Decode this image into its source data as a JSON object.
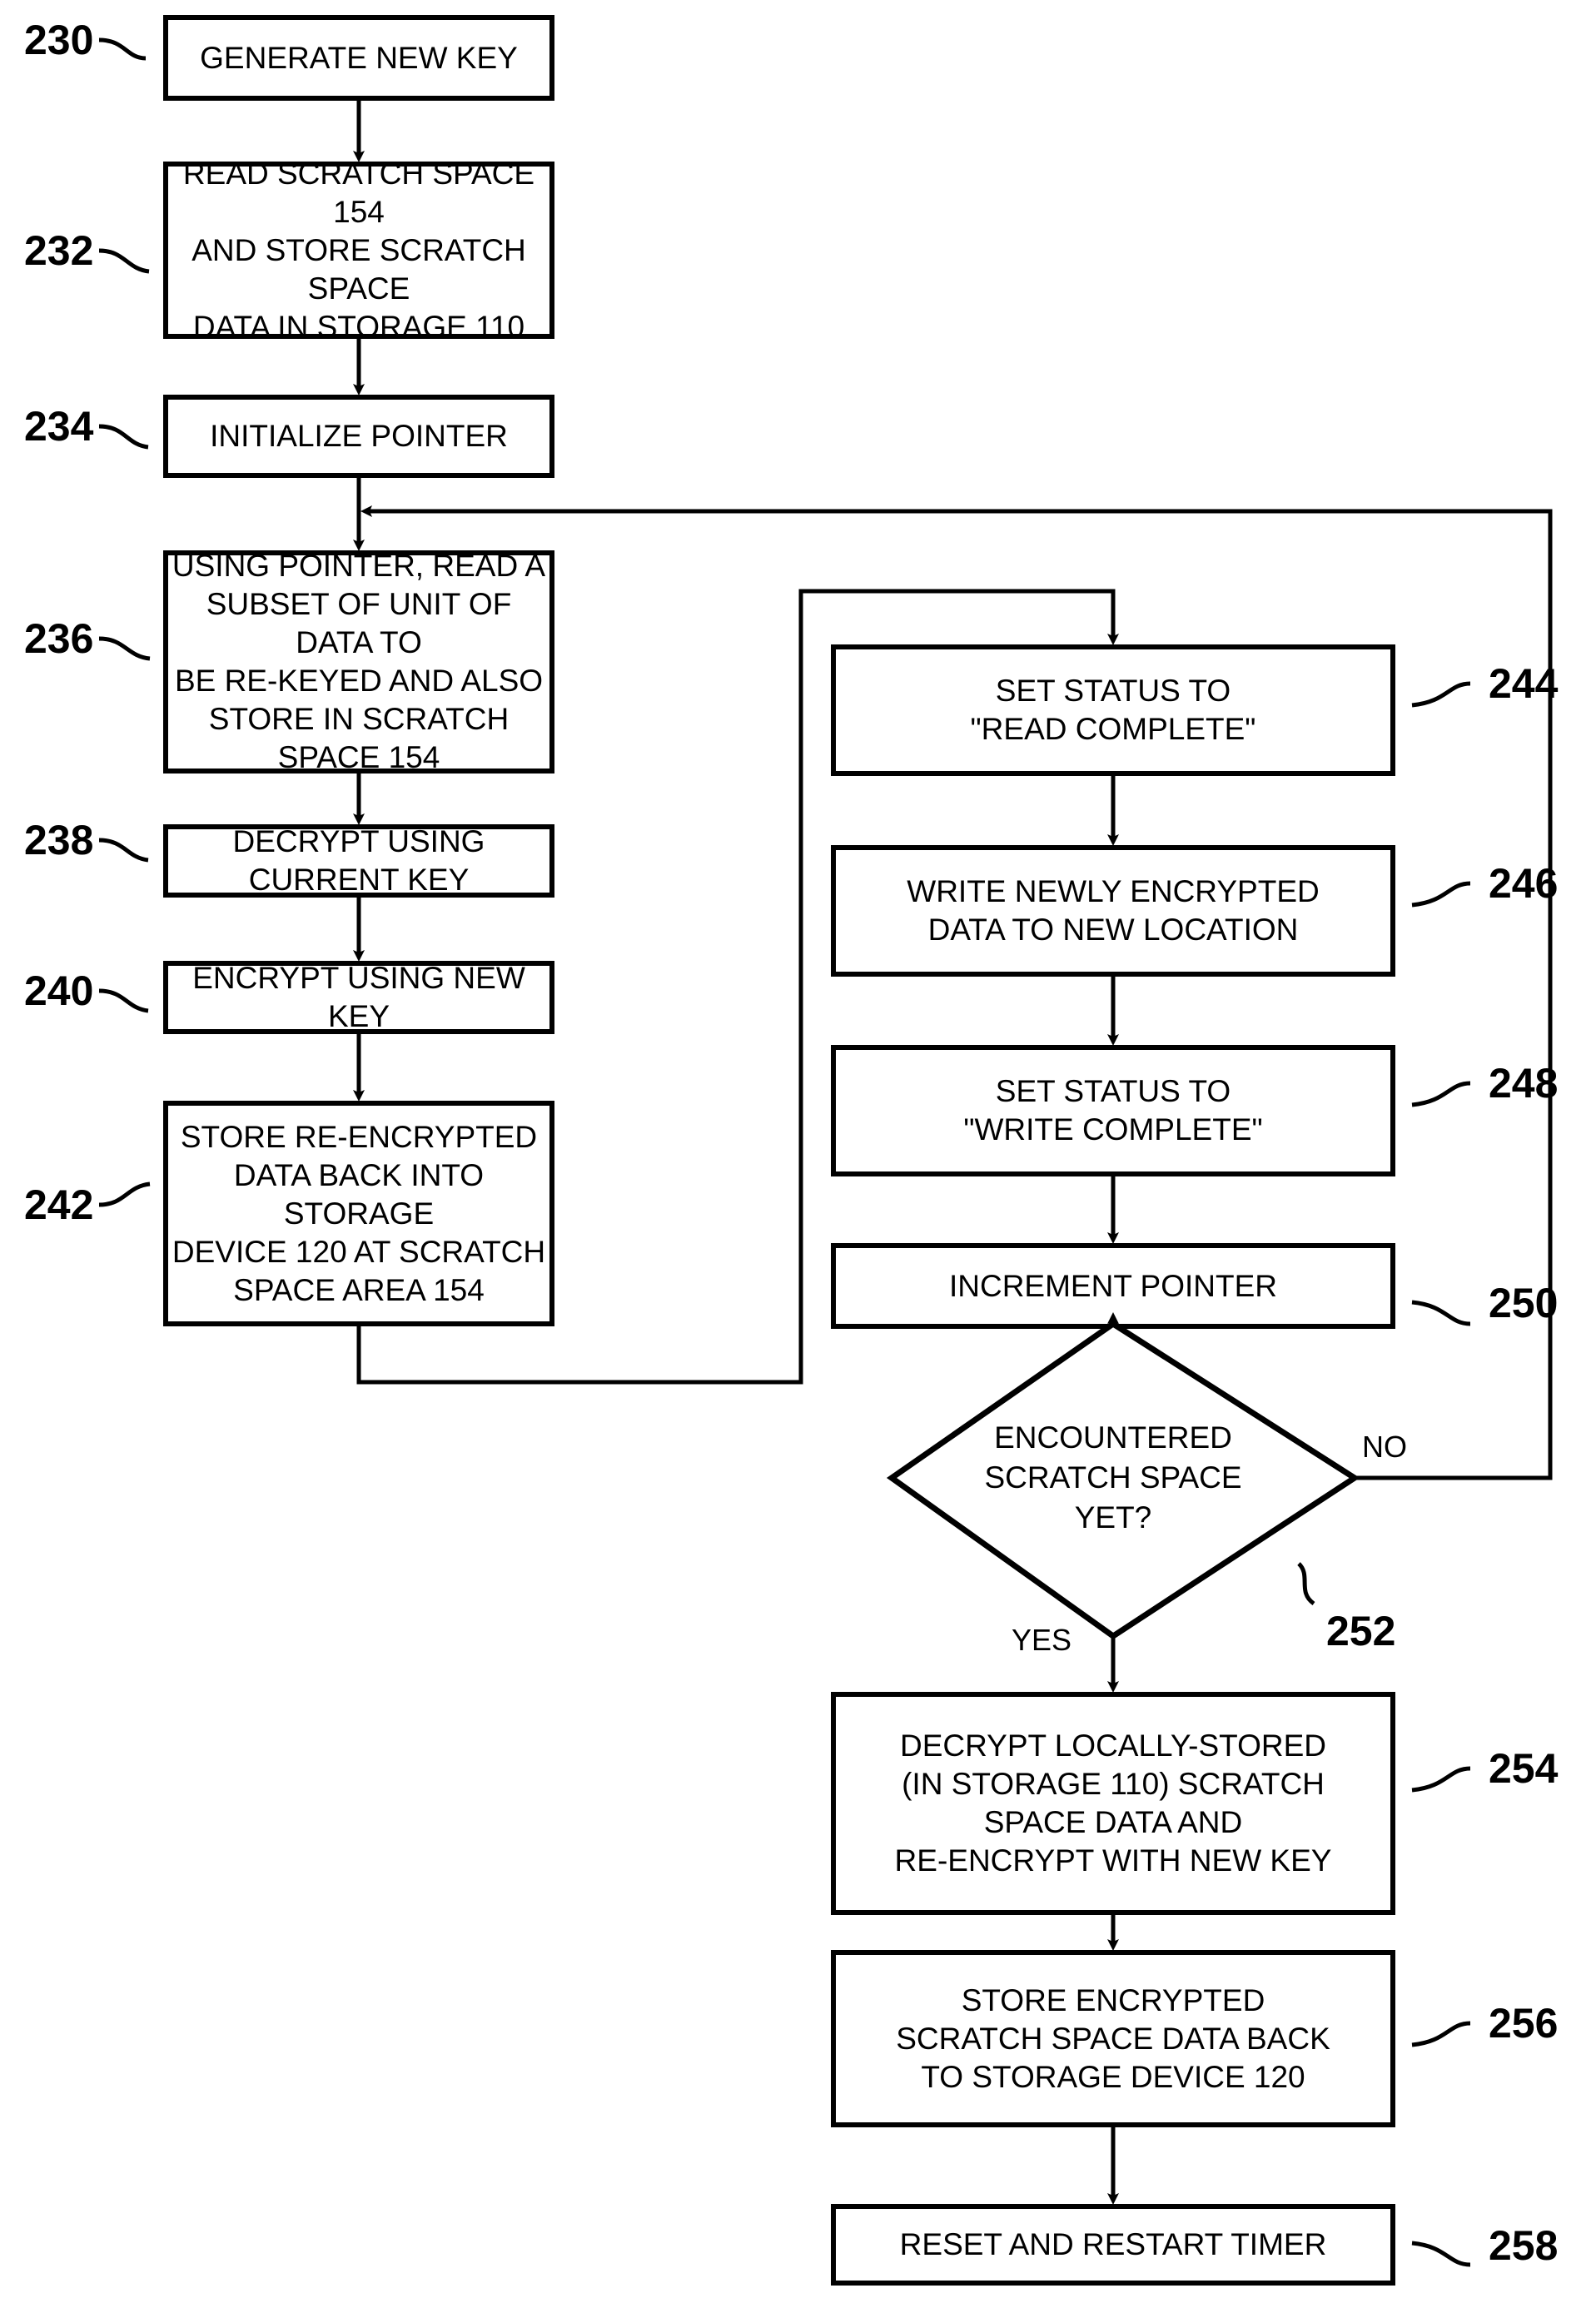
{
  "figure": {
    "type": "patent-flowchart",
    "nodes": [
      {
        "id": "n230",
        "ref": "230",
        "shape": "process",
        "text": "GENERATE NEW KEY"
      },
      {
        "id": "n232",
        "ref": "232",
        "shape": "process",
        "text": "READ SCRATCH SPACE 154\nAND STORE SCRATCH SPACE\nDATA IN STORAGE 110"
      },
      {
        "id": "n234",
        "ref": "234",
        "shape": "process",
        "text": "INITIALIZE POINTER"
      },
      {
        "id": "n236",
        "ref": "236",
        "shape": "process",
        "text": "USING POINTER, READ A\nSUBSET OF UNIT OF DATA TO\nBE RE-KEYED AND ALSO\nSTORE IN SCRATCH SPACE 154"
      },
      {
        "id": "n238",
        "ref": "238",
        "shape": "process",
        "text": "DECRYPT USING CURRENT KEY"
      },
      {
        "id": "n240",
        "ref": "240",
        "shape": "process",
        "text": "ENCRYPT USING NEW KEY"
      },
      {
        "id": "n242",
        "ref": "242",
        "shape": "process",
        "text": "STORE RE-ENCRYPTED\nDATA BACK INTO STORAGE\nDEVICE 120 AT SCRATCH\nSPACE AREA 154"
      },
      {
        "id": "n244",
        "ref": "244",
        "shape": "process",
        "text": "SET STATUS TO\n\"READ COMPLETE\""
      },
      {
        "id": "n246",
        "ref": "246",
        "shape": "process",
        "text": "WRITE NEWLY ENCRYPTED\nDATA TO NEW LOCATION"
      },
      {
        "id": "n248",
        "ref": "248",
        "shape": "process",
        "text": "SET STATUS TO\n\"WRITE COMPLETE\""
      },
      {
        "id": "n250",
        "ref": "250",
        "shape": "process",
        "text": "INCREMENT POINTER"
      },
      {
        "id": "n252",
        "ref": "252",
        "shape": "decision",
        "text": "ENCOUNTERED\nSCRATCH SPACE\nYET?"
      },
      {
        "id": "n254",
        "ref": "254",
        "shape": "process",
        "text": "DECRYPT LOCALLY-STORED\n(IN STORAGE 110) SCRATCH\nSPACE DATA AND\nRE-ENCRYPT WITH NEW KEY"
      },
      {
        "id": "n256",
        "ref": "256",
        "shape": "process",
        "text": "STORE ENCRYPTED\nSCRATCH SPACE DATA BACK\nTO STORAGE DEVICE 120"
      },
      {
        "id": "n258",
        "ref": "258",
        "shape": "process",
        "text": "RESET AND RESTART TIMER"
      }
    ],
    "edge_labels": {
      "decision_no": "NO",
      "decision_yes": "YES"
    },
    "colors": {
      "stroke": "#000000",
      "fill": "#ffffff",
      "text": "#000000"
    }
  }
}
